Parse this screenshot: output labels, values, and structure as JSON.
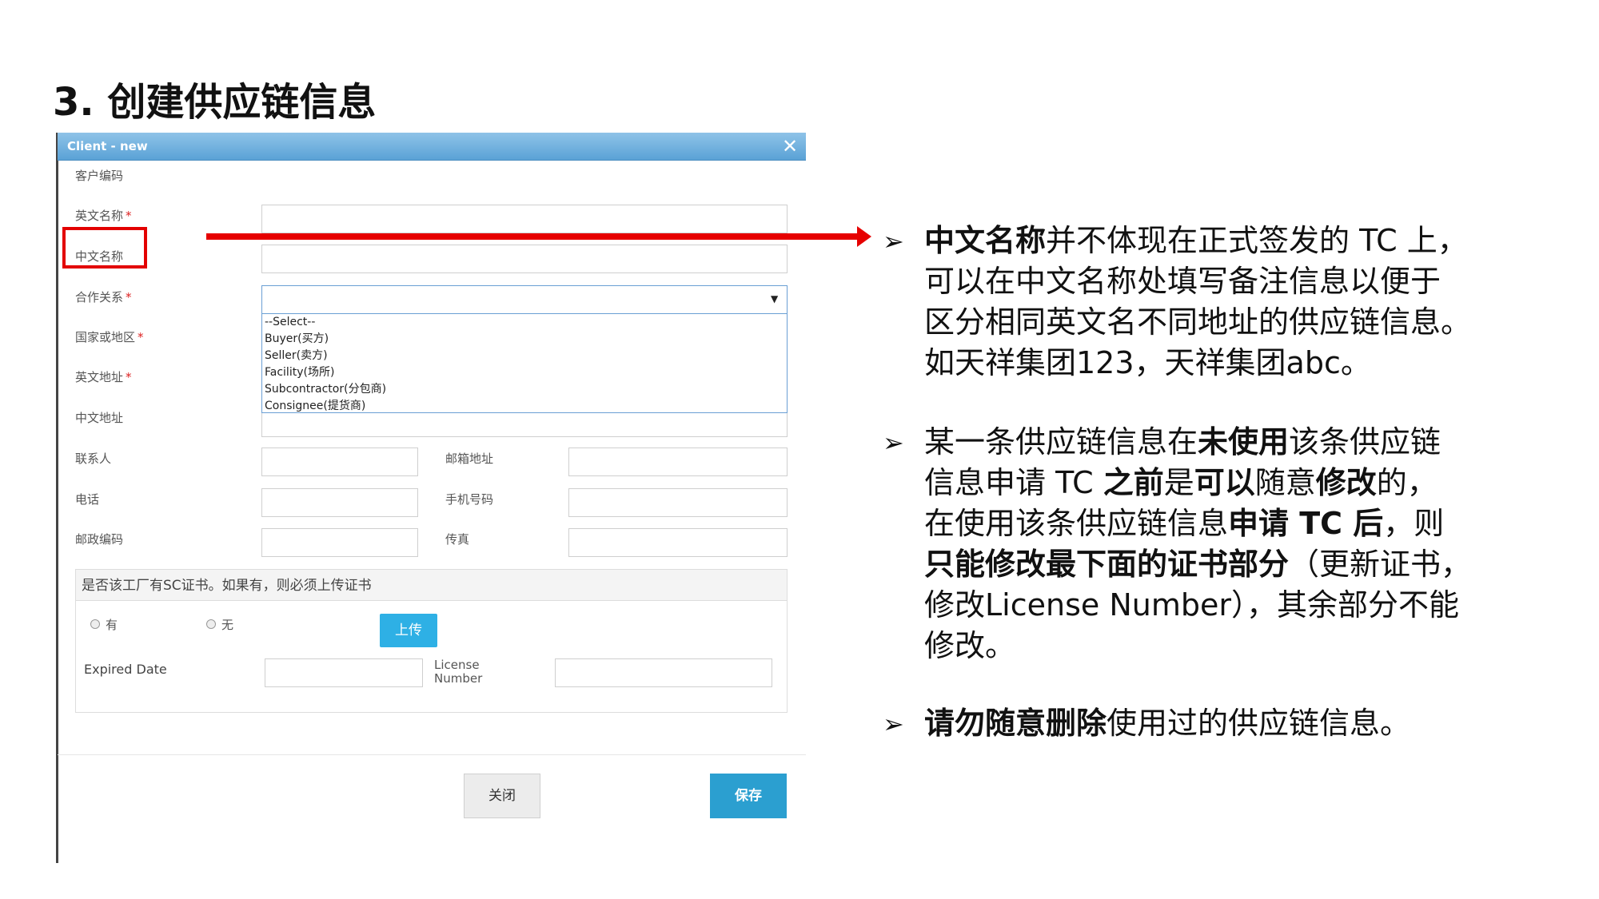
{
  "slide_title": "3. 创建供应链信息",
  "dialog": {
    "title": "Client - new",
    "close_glyph": "✕",
    "labels": {
      "customer_code": "客户编码",
      "english_name": "英文名称",
      "chinese_name": "中文名称",
      "cooperation": "合作关系",
      "country": "国家或地区",
      "english_address": "英文地址",
      "chinese_address": "中文地址",
      "contact": "联系人",
      "email": "邮箱地址",
      "phone": "电话",
      "mobile": "手机号码",
      "postcode": "邮政编码",
      "fax": "传真"
    },
    "required_mark": "*",
    "select_options": [
      "--Select--",
      "Buyer(买方)",
      "Seller(卖方)",
      "Facility(场所)",
      "Subcontractor(分包商)",
      "Consignee(提货商)"
    ],
    "select_arrow": "▼",
    "sc_section": {
      "header": "是否该工厂有SC证书。如果有，则必须上传证书",
      "radio_yes": "有",
      "radio_no": "无",
      "upload_label": "上传",
      "expired_date_label": "Expired Date",
      "license_label_1": "License",
      "license_label_2": "Number"
    },
    "buttons": {
      "close": "关闭",
      "save": "保存"
    }
  },
  "notes": {
    "arrow_glyph": "➢",
    "b1": {
      "l1_bold": "中文名称",
      "l1_rest": "并不体现在正式签发的 TC 上，",
      "l2": "可以在中文名称处填写备注信息以便于",
      "l3": "区分相同英文名不同地址的供应链信息。",
      "l4": "如天祥集团123，天祥集团abc。"
    },
    "b2": {
      "l1_a": "某一条供应链信息在",
      "l1_b": "未使用",
      "l1_c": "该条供应链",
      "l2_a": "信息申请 TC ",
      "l2_b": "之前",
      "l2_c": "是",
      "l2_d": "可以",
      "l2_e": "随意",
      "l2_f": "修改",
      "l2_g": "的，",
      "l3_a": "在使用该条供应链信息",
      "l3_b": "申请 TC 后",
      "l3_c": "，则",
      "l4_a": "只能修改最下面的证书部分",
      "l4_b": "（更新证书，",
      "l5": "修改License Number），其余部分不能",
      "l6": "修改。"
    },
    "b3": {
      "bold": "请勿随意删除",
      "rest": "使用过的供应链信息。"
    }
  }
}
